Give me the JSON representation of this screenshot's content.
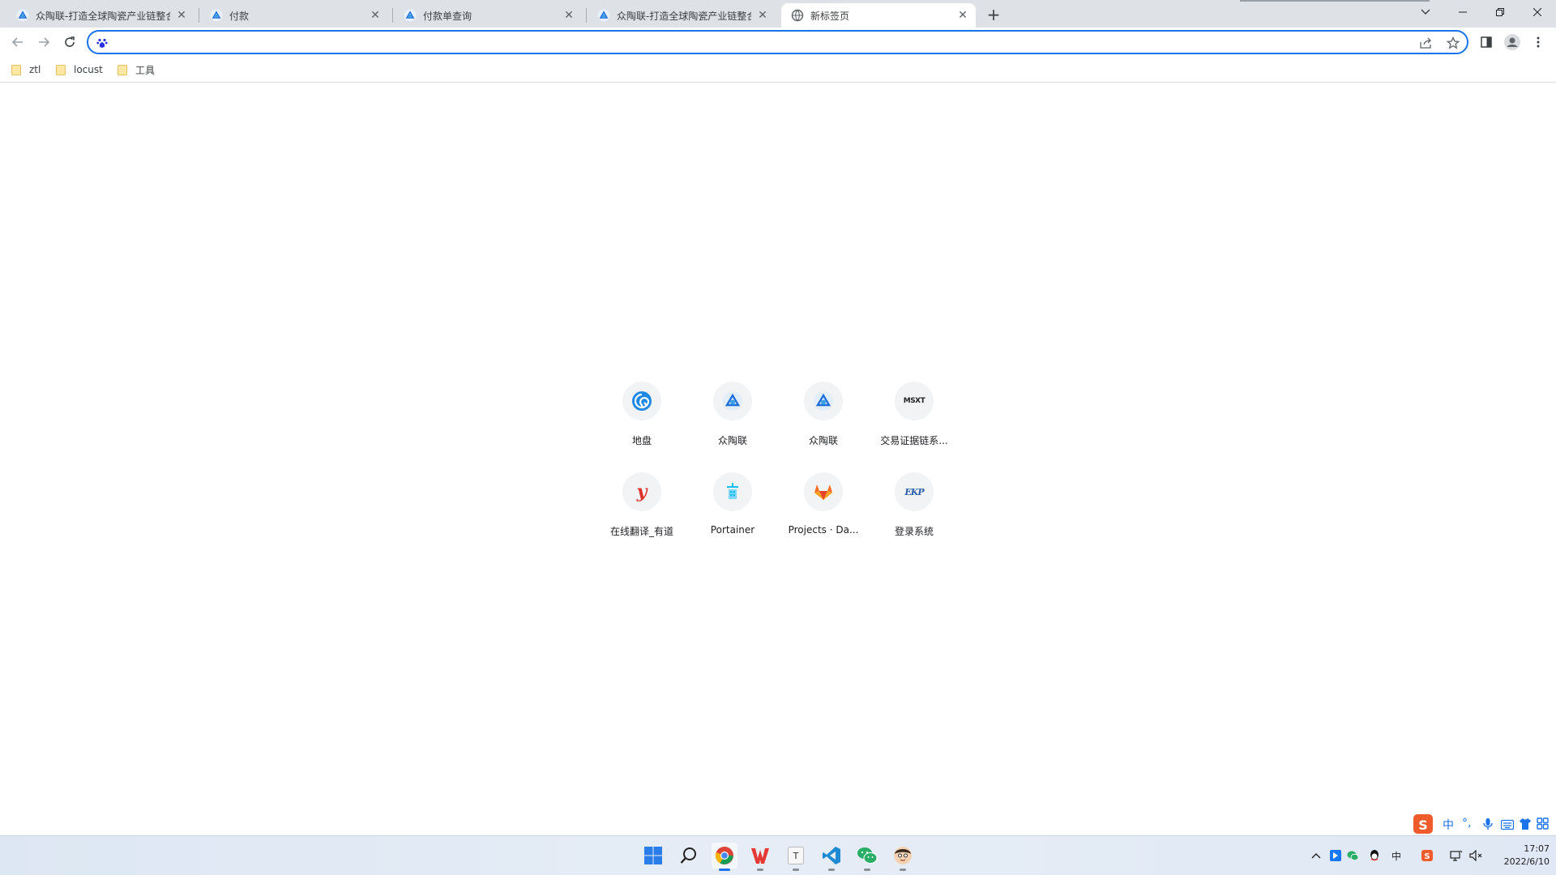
{
  "browser": {
    "tabs": [
      {
        "title": "众陶联-打造全球陶瓷产业链整合",
        "favicon": "ztl-logo-icon"
      },
      {
        "title": "付款",
        "favicon": "ztl-logo-icon"
      },
      {
        "title": "付款单查询",
        "favicon": "ztl-logo-icon"
      },
      {
        "title": "众陶联-打造全球陶瓷产业链整合",
        "favicon": "ztl-logo-icon"
      },
      {
        "title": "新标签页",
        "favicon": "globe-icon",
        "active": true
      }
    ],
    "close_glyph": "✕",
    "new_tab_glyph": "+",
    "omnibox": {
      "value": "",
      "placeholder": "",
      "search_engine_icon": "baidu-paw-icon"
    }
  },
  "bookmarks": [
    {
      "label": "ztl"
    },
    {
      "label": "locust"
    },
    {
      "label": "工具"
    }
  ],
  "shortcuts": [
    {
      "label": "地盘",
      "icon": "diban-swirl-icon"
    },
    {
      "label": "众陶联",
      "icon": "ztl-logo-icon"
    },
    {
      "label": "众陶联",
      "icon": "ztl-logo-icon"
    },
    {
      "label": "交易证据链系...",
      "icon": "msxt-logo-icon",
      "icon_text": "MSXT"
    },
    {
      "label": "在线翻译_有道",
      "icon": "youdao-icon",
      "icon_text": "y"
    },
    {
      "label": "Portainer",
      "icon": "portainer-icon"
    },
    {
      "label": "Projects · Da...",
      "icon": "gitlab-icon"
    },
    {
      "label": "登录系统",
      "icon": "ekp-logo-icon",
      "icon_text": "EKP"
    }
  ],
  "ime": {
    "mode": "中",
    "punct": "°,"
  },
  "taskbar": {
    "apps": [
      "windows-start-icon",
      "search-icon",
      "chrome-icon",
      "wps-icon",
      "typora-icon",
      "vscode-icon",
      "wechat-icon",
      "avatar-app-icon"
    ]
  },
  "clock": {
    "time": "17:07",
    "date": "2022/6/10"
  },
  "tray": {
    "language": "中"
  }
}
